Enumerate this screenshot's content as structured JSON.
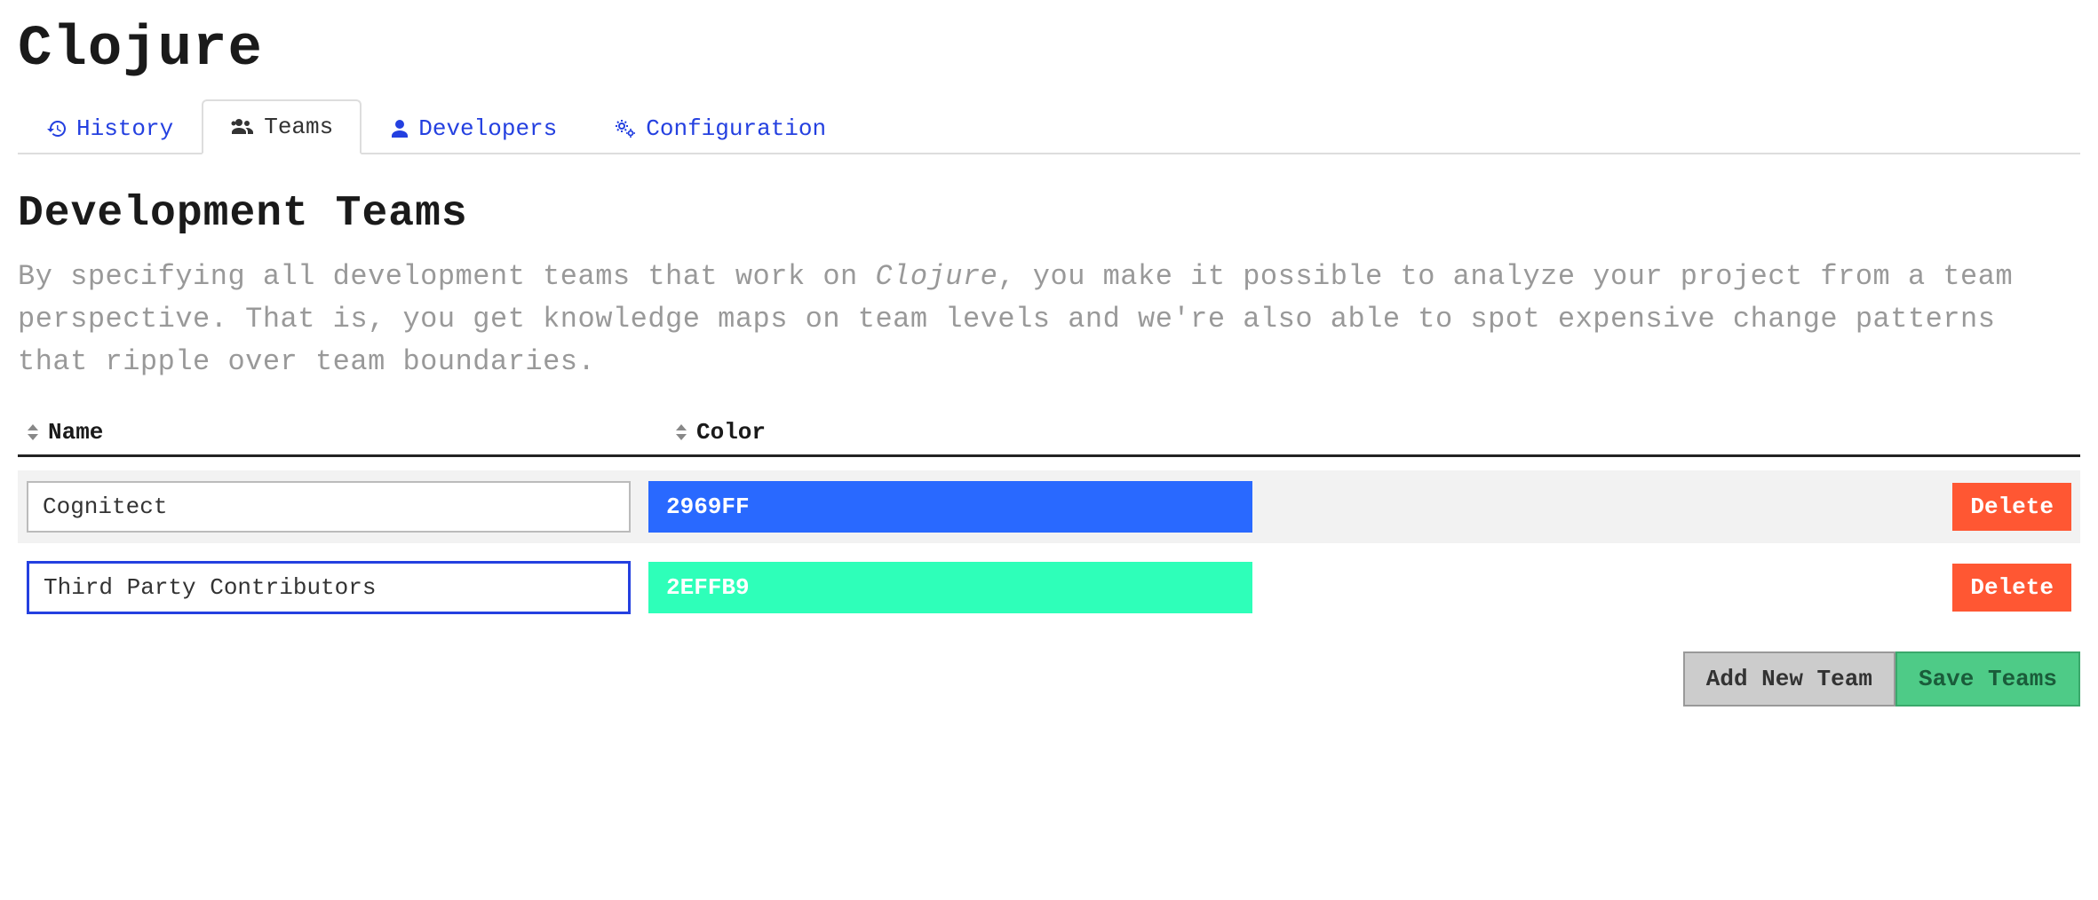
{
  "page_title": "Clojure",
  "tabs": [
    {
      "label": "History",
      "icon": "history-icon"
    },
    {
      "label": "Teams",
      "icon": "users-icon",
      "active": true
    },
    {
      "label": "Developers",
      "icon": "user-icon"
    },
    {
      "label": "Configuration",
      "icon": "cogs-icon"
    }
  ],
  "section": {
    "title": "Development Teams",
    "description_prefix": "By specifying all development teams that work on ",
    "description_project": "Clojure",
    "description_suffix": ", you make it possible to analyze your project from a team perspective. That is, you get knowledge maps on team levels and we're also able to spot expensive change patterns that ripple over team boundaries."
  },
  "table": {
    "columns": {
      "name": "Name",
      "color": "Color"
    },
    "rows": [
      {
        "name": "Cognitect",
        "color_hex": "2969FF",
        "color_bg": "#2969FF",
        "highlighted": true,
        "focused": false
      },
      {
        "name": "Third Party Contributors",
        "color_hex": "2EFFB9",
        "color_bg": "#2EFFB9",
        "highlighted": false,
        "focused": true
      }
    ],
    "delete_label": "Delete"
  },
  "actions": {
    "add_label": "Add New Team",
    "save_label": "Save Teams"
  }
}
